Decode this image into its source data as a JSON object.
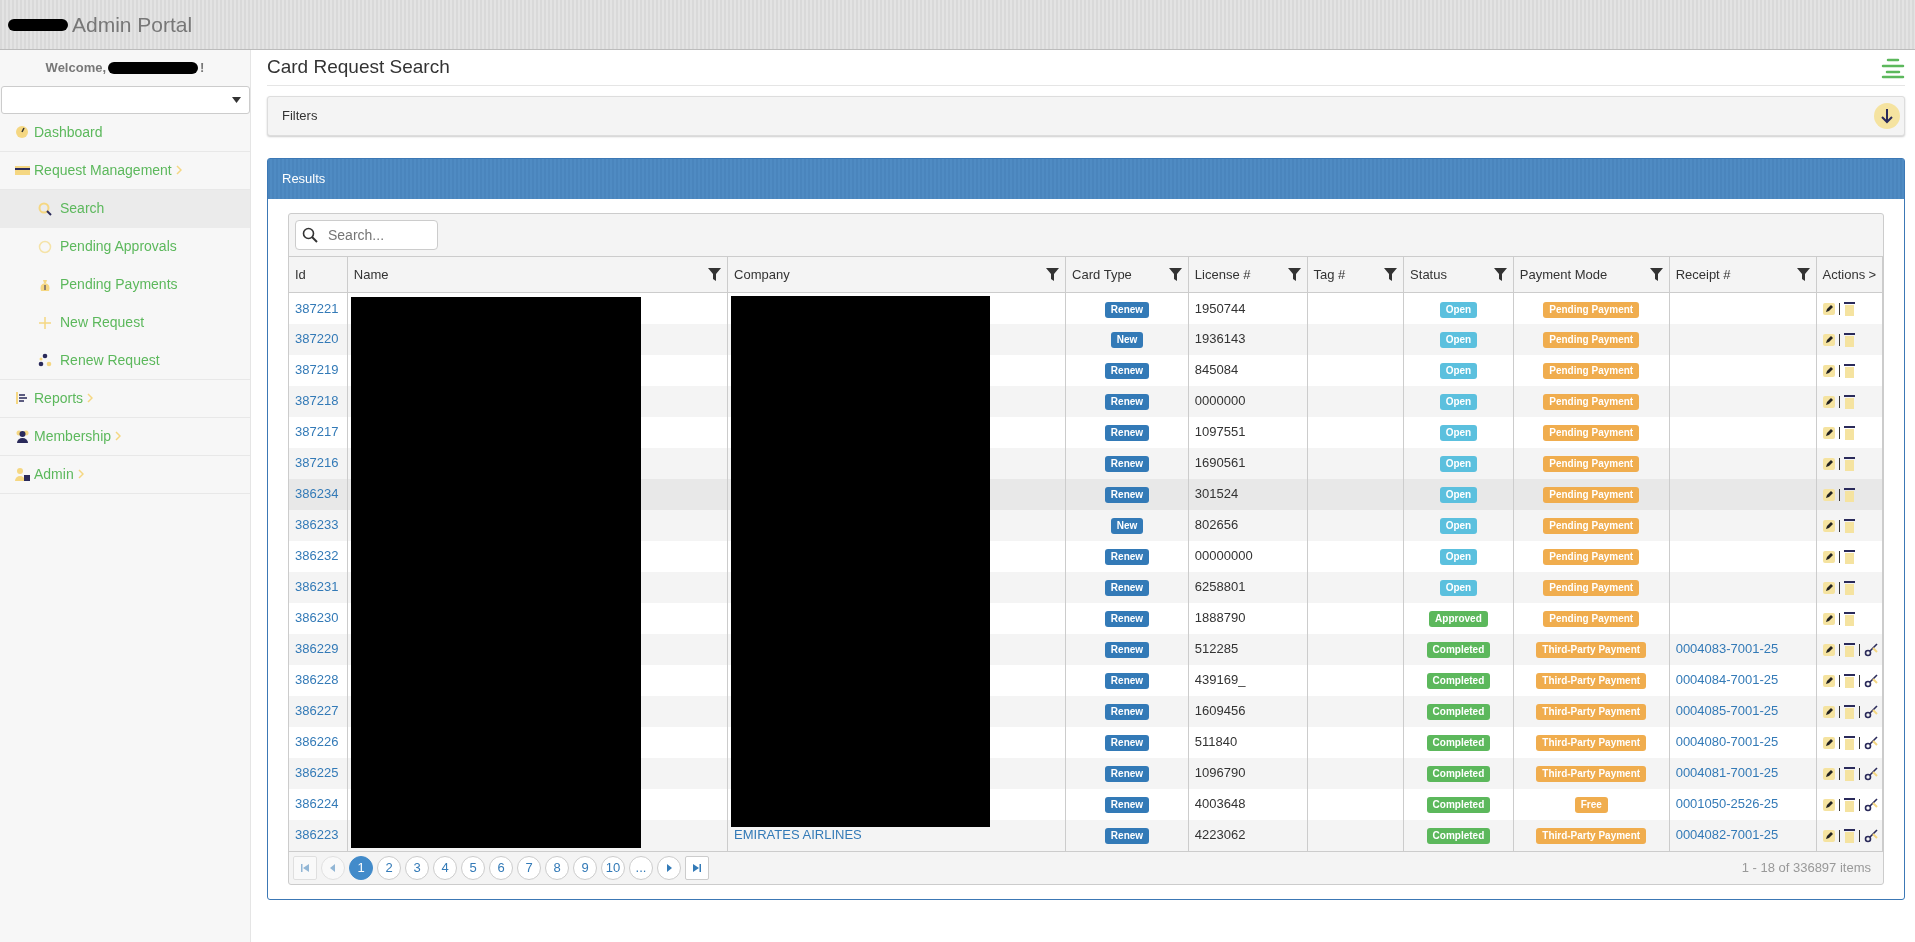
{
  "header": {
    "title": "Admin Portal"
  },
  "sidebar": {
    "welcome": "Welcome,",
    "welcome_end": "!",
    "items": [
      {
        "label": "Dashboard",
        "selected": false,
        "kind": "link"
      },
      {
        "label": "Request Management",
        "selected": false,
        "kind": "group",
        "children": [
          {
            "label": "Search",
            "selected": true
          },
          {
            "label": "Pending Approvals",
            "selected": false
          },
          {
            "label": "Pending Payments",
            "selected": false
          },
          {
            "label": "New Request",
            "selected": false
          },
          {
            "label": "Renew Request",
            "selected": false
          }
        ]
      },
      {
        "label": "Reports",
        "selected": false,
        "kind": "group"
      },
      {
        "label": "Membership",
        "selected": false,
        "kind": "group"
      },
      {
        "label": "Admin",
        "selected": false,
        "kind": "group"
      }
    ]
  },
  "page_title": "Card Request Search",
  "filters": {
    "title": "Filters"
  },
  "results": {
    "title": "Results",
    "search_placeholder": "Search...",
    "columns": [
      {
        "label": "Id",
        "filterable": false
      },
      {
        "label": "Name",
        "filterable": true
      },
      {
        "label": "Company",
        "filterable": true
      },
      {
        "label": "Card Type",
        "filterable": true
      },
      {
        "label": "License #",
        "filterable": true
      },
      {
        "label": "Tag #",
        "filterable": true
      },
      {
        "label": "Status",
        "filterable": true
      },
      {
        "label": "Payment Mode",
        "filterable": true
      },
      {
        "label": "Receipt #",
        "filterable": true
      },
      {
        "label": "Actions",
        "filterable": false,
        "more": ">"
      }
    ],
    "rows": [
      {
        "id": "387221",
        "selected": false,
        "card_type": "Renew",
        "license": "1950744",
        "status": {
          "text": "Open",
          "color": "#5bc0de"
        },
        "payment": "Pending Payment",
        "actions": [
          {
            "kind": "edit"
          },
          {
            "kind": "delete"
          }
        ]
      },
      {
        "id": "387220",
        "selected": false,
        "card_type": "New",
        "license": "1936143",
        "status": {
          "text": "Open",
          "color": "#5bc0de"
        },
        "payment": "Pending Payment",
        "actions": [
          {
            "kind": "edit"
          },
          {
            "kind": "delete"
          }
        ]
      },
      {
        "id": "387219",
        "selected": false,
        "card_type": "Renew",
        "license": "845084",
        "status": {
          "text": "Open",
          "color": "#5bc0de"
        },
        "payment": "Pending Payment",
        "actions": [
          {
            "kind": "edit"
          },
          {
            "kind": "delete"
          }
        ]
      },
      {
        "id": "387218",
        "selected": false,
        "card_type": "Renew",
        "license": "0000000",
        "status": {
          "text": "Open",
          "color": "#5bc0de"
        },
        "payment": "Pending Payment",
        "actions": [
          {
            "kind": "edit"
          },
          {
            "kind": "delete"
          }
        ]
      },
      {
        "id": "387217",
        "selected": false,
        "card_type": "Renew",
        "license": "1097551",
        "status": {
          "text": "Open",
          "color": "#5bc0de"
        },
        "payment": "Pending Payment",
        "actions": [
          {
            "kind": "edit"
          },
          {
            "kind": "delete"
          }
        ]
      },
      {
        "id": "387216",
        "selected": false,
        "card_type": "Renew",
        "license": "1690561",
        "status": {
          "text": "Open",
          "color": "#5bc0de"
        },
        "payment": "Pending Payment",
        "actions": [
          {
            "kind": "edit"
          },
          {
            "kind": "delete"
          }
        ]
      },
      {
        "id": "386234",
        "selected": true,
        "card_type": "Renew",
        "license": "301524",
        "status": {
          "text": "Open",
          "color": "#5bc0de"
        },
        "payment": "Pending Payment",
        "actions": [
          {
            "kind": "edit"
          },
          {
            "kind": "delete"
          }
        ]
      },
      {
        "id": "386233",
        "selected": false,
        "card_type": "New",
        "license": "802656",
        "status": {
          "text": "Open",
          "color": "#5bc0de"
        },
        "payment": "Pending Payment",
        "actions": [
          {
            "kind": "edit"
          },
          {
            "kind": "delete"
          }
        ]
      },
      {
        "id": "386232",
        "selected": false,
        "card_type": "Renew",
        "license": "00000000",
        "status": {
          "text": "Open",
          "color": "#5bc0de"
        },
        "payment": "Pending Payment",
        "actions": [
          {
            "kind": "edit"
          },
          {
            "kind": "delete"
          }
        ]
      },
      {
        "id": "386231",
        "selected": false,
        "card_type": "Renew",
        "license": "6258801",
        "status": {
          "text": "Open",
          "color": "#5bc0de"
        },
        "payment": "Pending Payment",
        "actions": [
          {
            "kind": "edit"
          },
          {
            "kind": "delete"
          }
        ]
      },
      {
        "id": "386230",
        "selected": false,
        "card_type": "Renew",
        "license": "1888790",
        "status": {
          "text": "Approved",
          "color": "#5cb85c"
        },
        "payment": "Pending Payment",
        "actions": [
          {
            "kind": "edit"
          },
          {
            "kind": "delete"
          }
        ]
      },
      {
        "id": "386229",
        "selected": false,
        "card_type": "Renew",
        "license": "512285",
        "status": {
          "text": "Completed",
          "color": "#5cb85c"
        },
        "payment": "Third-Party Payment",
        "receipt": "0004083-7001-25",
        "actions": [
          {
            "kind": "edit"
          },
          {
            "kind": "delete"
          },
          {
            "kind": "key"
          }
        ]
      },
      {
        "id": "386228",
        "selected": false,
        "card_type": "Renew",
        "license": "439169_",
        "status": {
          "text": "Completed",
          "color": "#5cb85c"
        },
        "payment": "Third-Party Payment",
        "receipt": "0004084-7001-25",
        "actions": [
          {
            "kind": "edit"
          },
          {
            "kind": "delete"
          },
          {
            "kind": "key"
          }
        ]
      },
      {
        "id": "386227",
        "selected": false,
        "card_type": "Renew",
        "license": "1609456",
        "status": {
          "text": "Completed",
          "color": "#5cb85c"
        },
        "payment": "Third-Party Payment",
        "receipt": "0004085-7001-25",
        "actions": [
          {
            "kind": "edit"
          },
          {
            "kind": "delete"
          },
          {
            "kind": "key"
          }
        ]
      },
      {
        "id": "386226",
        "selected": false,
        "card_type": "Renew",
        "license": "511840",
        "status": {
          "text": "Completed",
          "color": "#5cb85c"
        },
        "payment": "Third-Party Payment",
        "receipt": "0004080-7001-25",
        "actions": [
          {
            "kind": "edit"
          },
          {
            "kind": "delete"
          },
          {
            "kind": "key"
          }
        ]
      },
      {
        "id": "386225",
        "selected": false,
        "card_type": "Renew",
        "license": "1096790",
        "status": {
          "text": "Completed",
          "color": "#5cb85c"
        },
        "payment": "Third-Party Payment",
        "receipt": "0004081-7001-25",
        "actions": [
          {
            "kind": "edit"
          },
          {
            "kind": "delete"
          },
          {
            "kind": "key"
          }
        ]
      },
      {
        "id": "386224",
        "selected": false,
        "card_type": "Renew",
        "license": "4003648",
        "status": {
          "text": "Completed",
          "color": "#5cb85c"
        },
        "payment": "Free",
        "receipt": "0001050-2526-25",
        "actions": [
          {
            "kind": "edit"
          },
          {
            "kind": "delete"
          },
          {
            "kind": "key"
          }
        ]
      },
      {
        "id": "386223",
        "selected": false,
        "card_type": "Renew",
        "license": "4223062",
        "company": "EMIRATES AIRLINES",
        "status": {
          "text": "Completed",
          "color": "#5cb85c"
        },
        "payment": "Third-Party Payment",
        "receipt": "0004082-7001-25",
        "actions": [
          {
            "kind": "edit"
          },
          {
            "kind": "delete"
          },
          {
            "kind": "key"
          }
        ]
      }
    ],
    "pager": {
      "first": {
        "disabled": true
      },
      "prev": {
        "disabled": true
      },
      "pages": [
        {
          "label": "1",
          "selected": true
        },
        {
          "label": "2",
          "selected": false
        },
        {
          "label": "3",
          "selected": false
        },
        {
          "label": "4",
          "selected": false
        },
        {
          "label": "5",
          "selected": false
        },
        {
          "label": "6",
          "selected": false
        },
        {
          "label": "7",
          "selected": false
        },
        {
          "label": "8",
          "selected": false
        },
        {
          "label": "9",
          "selected": false
        },
        {
          "label": "10",
          "selected": false
        },
        {
          "label": "...",
          "selected": false
        }
      ],
      "next": {
        "disabled": false
      },
      "last": {
        "disabled": false
      },
      "info": "1 - 18 of 336897 items"
    }
  }
}
